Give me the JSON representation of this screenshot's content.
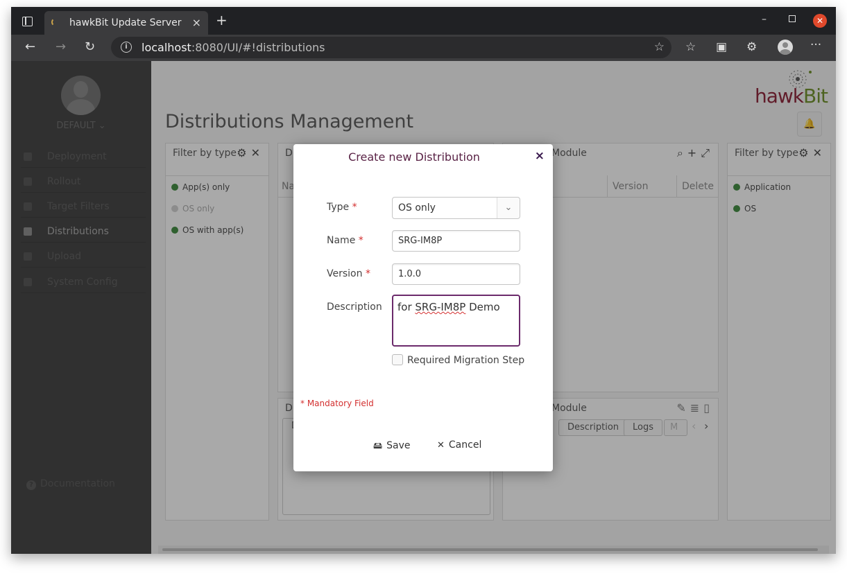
{
  "browser": {
    "tab_title": "hawkBit Update Server",
    "tab_close": "×",
    "new_tab": "+",
    "url_host": "localhost",
    "url_path": ":8080/UI/#!distributions"
  },
  "sidebar": {
    "tenant": "DEFAULT ⌄",
    "items": [
      {
        "label": "Deployment"
      },
      {
        "label": "Rollout"
      },
      {
        "label": "Target Filters"
      },
      {
        "label": "Distributions"
      },
      {
        "label": "Upload"
      },
      {
        "label": "System Config"
      }
    ],
    "documentation": "Documentation"
  },
  "main": {
    "logo_part1": "hawk",
    "logo_part2": "Bit",
    "page_title": "Distributions Management",
    "left_filter": {
      "title": "Filter by type",
      "items": [
        "App(s) only",
        "OS only",
        "OS with app(s)"
      ]
    },
    "dist_panel": {
      "title_fragment": "Di",
      "col_fragment": "Na"
    },
    "module_panel": {
      "title_fragment": "Module",
      "cols": [
        "Version",
        "Delete"
      ]
    },
    "right_filter": {
      "title": "Filter by type",
      "items": [
        "Application",
        "OS"
      ]
    },
    "details_left": {
      "title_fragment": "Di",
      "tab_fragment": "D"
    },
    "details_right": {
      "title_fragment": "Module",
      "tabs": [
        "Description",
        "Logs",
        "M"
      ]
    }
  },
  "dialog": {
    "title": "Create new Distribution",
    "close": "×",
    "type_label": "Type",
    "type_value": "OS only",
    "name_label": "Name",
    "name_value": "SRG-IM8P",
    "version_label": "Version",
    "version_value": "1.0.0",
    "description_label": "Description",
    "description_prefix": "for ",
    "description_marked": "SRG-IM8P",
    "description_suffix": " Demo",
    "required_star": "*",
    "migration_label": "Required Migration Step",
    "mandatory_note": "* Mandatory Field",
    "save_label": "Save",
    "cancel_label": "Cancel"
  }
}
